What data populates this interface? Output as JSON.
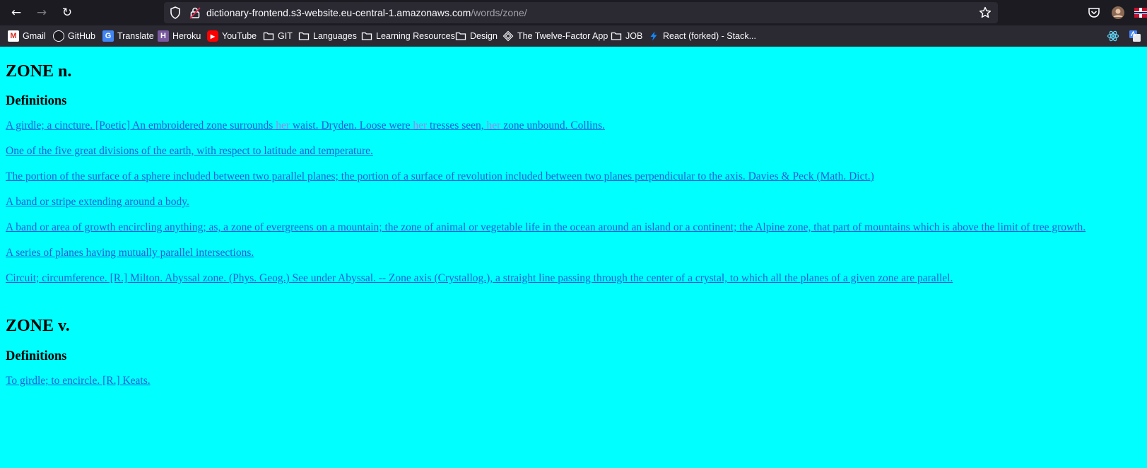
{
  "browser": {
    "url_host": "dictionary-frontend.s3-website.eu-central-1.amazonaws.com",
    "url_path": "/words/zone/",
    "bookmarks": [
      {
        "label": "Gmail",
        "icon": "gmail-icon"
      },
      {
        "label": "GitHub",
        "icon": "github-icon"
      },
      {
        "label": "Translate",
        "icon": "translate-icon"
      },
      {
        "label": "Heroku",
        "icon": "heroku-icon"
      },
      {
        "label": "YouTube",
        "icon": "youtube-icon"
      },
      {
        "label": "GIT",
        "icon": "folder-icon"
      },
      {
        "label": "Languages",
        "icon": "folder-icon"
      },
      {
        "label": "Learning Resources",
        "icon": "folder-icon"
      },
      {
        "label": "Design",
        "icon": "folder-icon"
      },
      {
        "label": "The Twelve-Factor App",
        "icon": "twelve-factor-icon"
      },
      {
        "label": "JOB",
        "icon": "folder-icon"
      },
      {
        "label": "React (forked) - Stack...",
        "icon": "stackblitz-icon"
      }
    ]
  },
  "entries": [
    {
      "title": "ZONE n.",
      "definitions_heading": "Definitions",
      "definitions": [
        {
          "parts": [
            {
              "t": "A girdle; a cincture. [Poetic] An embroidered zone surrounds "
            },
            {
              "t": "her",
              "hl": true
            },
            {
              "t": " waist. Dryden. Loose were "
            },
            {
              "t": "her",
              "hl": true
            },
            {
              "t": " tresses seen, "
            },
            {
              "t": "her",
              "hl": true
            },
            {
              "t": " zone unbound. Collins."
            }
          ]
        },
        {
          "parts": [
            {
              "t": "One of the five great divisions of the earth, with respect to latitude and temperature."
            }
          ]
        },
        {
          "parts": [
            {
              "t": "The portion of the surface of a sphere included between two parallel planes; the portion of a surface of revolution included between two planes perpendicular to the axis. Davies & Peck (Math. Dict.)"
            }
          ]
        },
        {
          "parts": [
            {
              "t": "A band or stripe extending around a body."
            }
          ]
        },
        {
          "parts": [
            {
              "t": "A band or area of growth encircling anything; as, a zone of evergreens on a mountain; the zone of animal or vegetable life in the ocean around an island or a continent; the Alpine zone, that part of mountains which is above the limit of tree growth."
            }
          ]
        },
        {
          "parts": [
            {
              "t": "A series of planes having mutually parallel intersections."
            }
          ]
        },
        {
          "parts": [
            {
              "t": "Circuit; circumference. [R.] Milton. Abyssal zone. (Phys. Geog.) See under Abyssal. -- Zone axis (Crystallog.), a straight line passing through the center of a crystal, to which all the planes of a given zone are parallel."
            }
          ]
        }
      ]
    },
    {
      "title": "ZONE v.",
      "definitions_heading": "Definitions",
      "definitions": [
        {
          "parts": [
            {
              "t": "To girdle; to encircle. [R.] Keats."
            }
          ]
        }
      ]
    }
  ],
  "colors": {
    "page_background": "#00ffff",
    "link": "#1a5fd6",
    "highlight": "#9b86e6"
  }
}
